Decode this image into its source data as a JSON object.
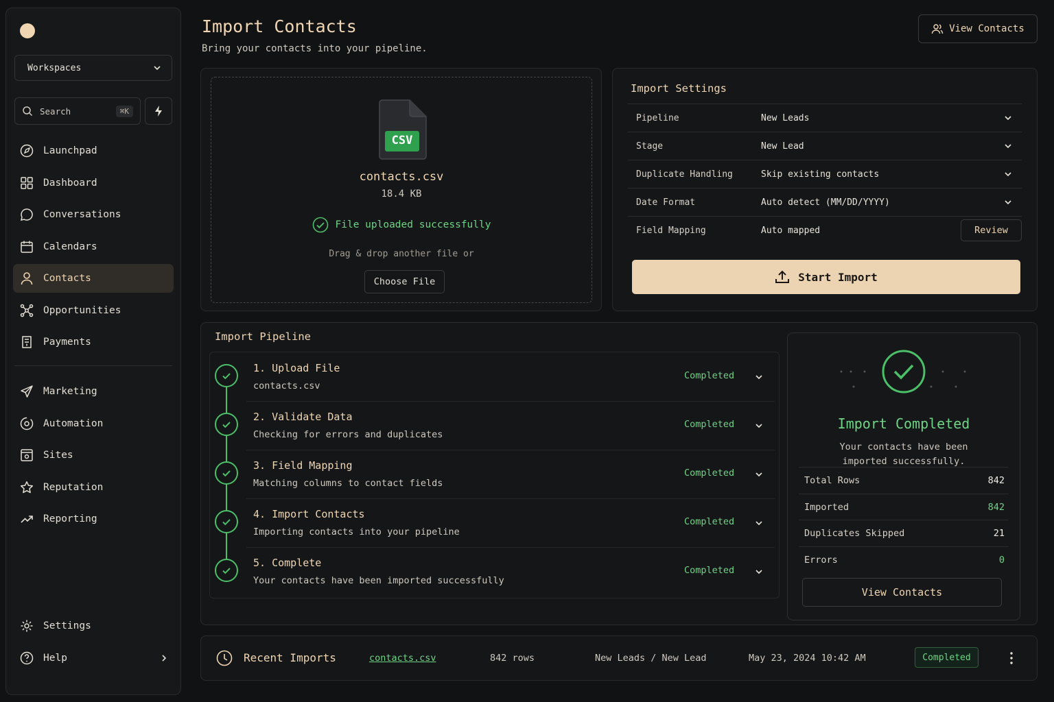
{
  "sidebar": {
    "workspace_label": "Workspaces",
    "search_label": "Search",
    "search_shortcut": "⌘K",
    "nav_primary": [
      {
        "label": "Launchpad",
        "icon": "rocket-icon"
      },
      {
        "label": "Dashboard",
        "icon": "grid-icon"
      },
      {
        "label": "Conversations",
        "icon": "chat-icon"
      },
      {
        "label": "Calendars",
        "icon": "calendar-icon"
      },
      {
        "label": "Contacts",
        "icon": "user-icon",
        "active": true
      },
      {
        "label": "Opportunities",
        "icon": "network-icon"
      },
      {
        "label": "Payments",
        "icon": "receipt-icon"
      }
    ],
    "nav_secondary": [
      {
        "label": "Marketing",
        "icon": "send-icon"
      },
      {
        "label": "Automation",
        "icon": "automation-icon"
      },
      {
        "label": "Sites",
        "icon": "sites-icon"
      },
      {
        "label": "Reputation",
        "icon": "star-icon"
      },
      {
        "label": "Reporting",
        "icon": "trend-icon"
      }
    ],
    "settings_label": "Settings",
    "help_label": "Help"
  },
  "header": {
    "title": "Import Contacts",
    "subtitle": "Bring your contacts into your pipeline.",
    "view_contacts_label": "View Contacts"
  },
  "upload": {
    "file_badge": "CSV",
    "file_name": "contacts.csv",
    "file_size": "18.4 KB",
    "status": "File uploaded successfully",
    "drag_text": "Drag & drop another file or",
    "choose_label": "Choose File"
  },
  "settings": {
    "title": "Import Settings",
    "rows": [
      {
        "label": "Pipeline",
        "value": "New Leads"
      },
      {
        "label": "Stage",
        "value": "New Lead"
      },
      {
        "label": "Duplicate Handling",
        "value": "Skip existing contacts"
      },
      {
        "label": "Date Format",
        "value": "Auto detect (MM/DD/YYYY)"
      },
      {
        "label": "Field Mapping",
        "value": "Auto mapped"
      }
    ],
    "review_label": "Review",
    "start_label": "Start Import"
  },
  "pipeline": {
    "title": "Import Pipeline",
    "steps": [
      {
        "title": "1. Upload File",
        "desc": "contacts.csv",
        "status": "Completed"
      },
      {
        "title": "2. Validate Data",
        "desc": "Checking for errors and duplicates",
        "status": "Completed"
      },
      {
        "title": "3. Field Mapping",
        "desc": "Matching columns to contact fields",
        "status": "Completed"
      },
      {
        "title": "4. Import Contacts",
        "desc": "Importing contacts into your pipeline",
        "status": "Completed"
      },
      {
        "title": "5. Complete",
        "desc": "Your contacts have been imported successfully",
        "status": "Completed"
      }
    ]
  },
  "result": {
    "title": "Import Completed",
    "subtitle": "Your contacts have been imported successfully.",
    "stats": [
      {
        "label": "Total Rows",
        "value": "842",
        "color": "#f0ebe2"
      },
      {
        "label": "Imported",
        "value": "842",
        "color": "#6fd486"
      },
      {
        "label": "Duplicates Skipped",
        "value": "21",
        "color": "#f0ebe2"
      },
      {
        "label": "Errors",
        "value": "0",
        "color": "#6fd486"
      }
    ],
    "button_label": "View Contacts"
  },
  "recent": {
    "title": "Recent Imports",
    "file": "contacts.csv",
    "rows": "842 rows",
    "pipeline": "New Leads / New Lead",
    "date": "May 23, 2024 10:42 AM",
    "status": "Completed"
  },
  "colors": {
    "accent": "#f0d6b3",
    "success": "#6fd486",
    "background": "#111214",
    "panel": "#151618"
  }
}
